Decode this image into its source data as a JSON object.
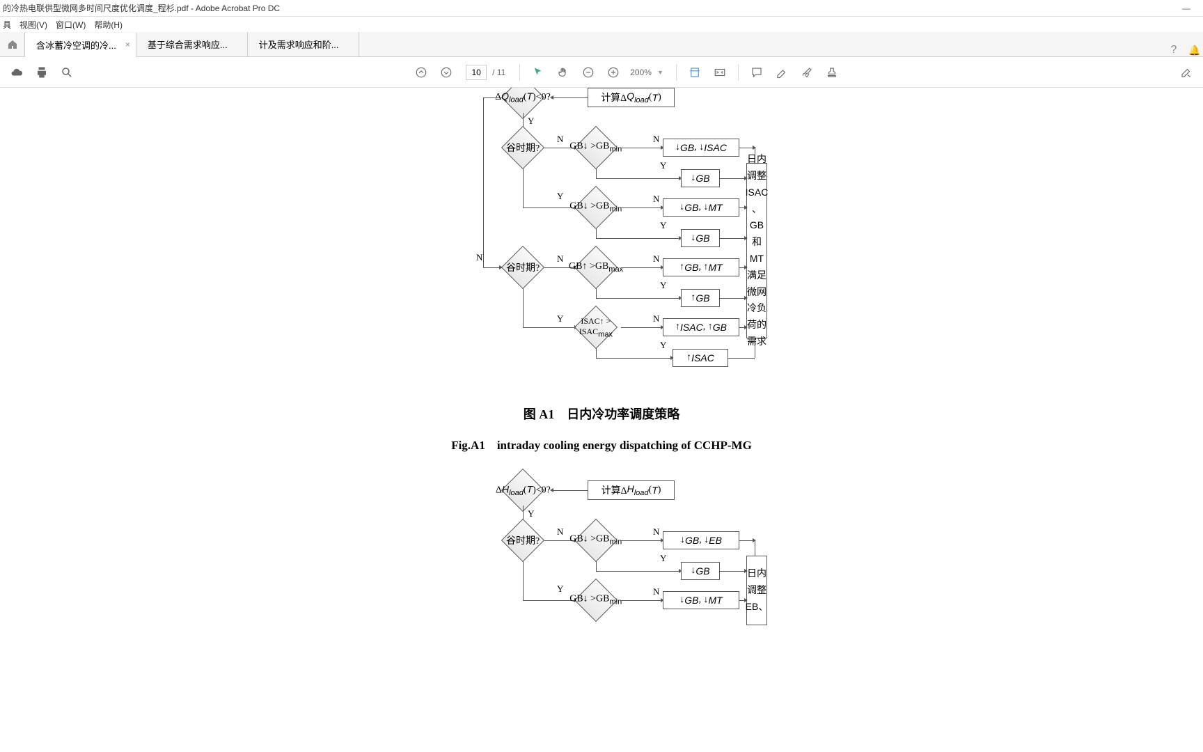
{
  "app": {
    "title": "的冷热电联供型微网多时间尺度优化调度_程杉.pdf - Adobe Acrobat Pro DC"
  },
  "menu": {
    "items": [
      "具",
      "视图(V)",
      "窗口(W)",
      "帮助(H)"
    ]
  },
  "tabs": {
    "home_icon": "home",
    "items": [
      {
        "label": "含冰蓄冷空调的冷...",
        "active": true
      },
      {
        "label": "基于综合需求响应...",
        "active": false
      },
      {
        "label": "计及需求响应和阶...",
        "active": false
      }
    ]
  },
  "toolbar": {
    "page_current": "10",
    "page_total": "/ 11",
    "zoom": "200%"
  },
  "figure1": {
    "caption_cn": "图 A1　日内冷功率调度策略",
    "caption_en": "Fig.A1　intraday cooling energy dispatching of CCHP-MG",
    "nodes": {
      "calc": "计算ΔQload(T)",
      "dq": "ΔQload(T)<0?",
      "valley1": "谷时期?",
      "valley2": "谷时期?",
      "gbdown1": "GB↓ >GBmin",
      "gbdown2": "GB↓ >GBmin",
      "gbup": "GB↑ >GBmax",
      "isacup": "ISAC↑ > ISACmax",
      "r_gb_isac": "↓ GB, ↓ ISAC",
      "r_gb1": "↓ GB",
      "r_gb_mt": "↓ GB, ↓ MT",
      "r_gb2": "↓ GB",
      "r_gbup_mt": "↑ GB, ↑ MT",
      "r_gbup": "↑ GB",
      "r_isac_gb": "↑ ISAC, ↑ GB",
      "r_isac": "↑ ISAC",
      "vertical": "日内调整ISAC 、GB和MT满足微网冷负荷的需求"
    },
    "labels": {
      "Y": "Y",
      "N": "N"
    }
  },
  "figure2": {
    "nodes": {
      "calc": "计算ΔHload(T)",
      "dh": "ΔHload(T)<0?",
      "valley": "谷时期?",
      "gbdown1": "GB↓ >GBmin",
      "gbdown2": "GB↓ >GBmin",
      "r_gb_eb": "↓ GB, ↓ EB",
      "r_gb": "↓ GB",
      "r_gb_mt": "↓ GB, ↓ MT",
      "vertical": "日内调整EB、"
    }
  }
}
